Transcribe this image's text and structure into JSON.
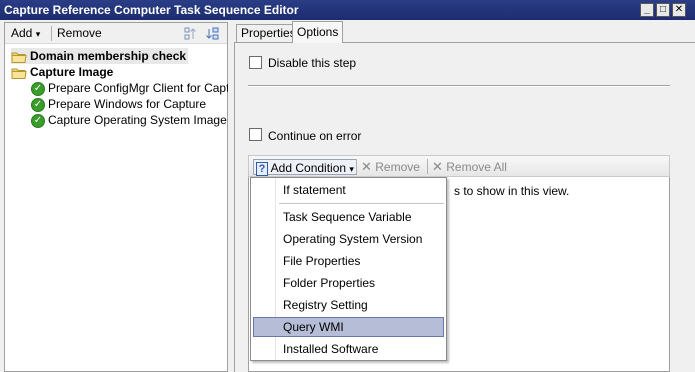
{
  "window": {
    "title": "Capture Reference Computer Task Sequence Editor",
    "controls": {
      "minimize": "_",
      "maximize": "□",
      "close": "✕"
    }
  },
  "left_toolbar": {
    "add_label": "Add",
    "add_arrow": "▾",
    "remove_label": "Remove",
    "icons": [
      "move-up-icon",
      "move-down-icon"
    ]
  },
  "tree": {
    "groups": [
      {
        "label": "Domain membership check",
        "icon": "folder-icon",
        "selected": true
      },
      {
        "label": "Capture Image",
        "icon": "folder-icon",
        "selected": false
      }
    ],
    "steps": [
      {
        "label": "Prepare ConfigMgr Client for Capture",
        "icon": "check-icon"
      },
      {
        "label": "Prepare Windows for Capture",
        "icon": "check-icon"
      },
      {
        "label": "Capture Operating System Image",
        "icon": "check-icon"
      }
    ]
  },
  "tabs": [
    {
      "label": "Properties",
      "active": false
    },
    {
      "label": "Options",
      "active": true
    }
  ],
  "options": {
    "disable_step_label": "Disable this step",
    "disable_step_checked": false,
    "continue_on_error_label": "Continue on error",
    "continue_on_error_checked": false
  },
  "conditions_toolbar": {
    "add_condition_label": "Add Condition",
    "add_condition_arrow": "▾",
    "remove_label": "Remove",
    "remove_all_label": "Remove All",
    "x_glyph": "✕",
    "help_glyph": "?"
  },
  "conditions_area": {
    "empty_text_visible": "s to show in this view."
  },
  "add_condition_menu": {
    "items": [
      {
        "label": "If statement",
        "highlighted": false
      },
      {
        "label": "Task Sequence Variable",
        "highlighted": false
      },
      {
        "label": "Operating System Version",
        "highlighted": false
      },
      {
        "label": "File Properties",
        "highlighted": false
      },
      {
        "label": "Folder Properties",
        "highlighted": false
      },
      {
        "label": "Registry Setting",
        "highlighted": false
      },
      {
        "label": "Query WMI",
        "highlighted": true
      },
      {
        "label": "Installed Software",
        "highlighted": false
      }
    ]
  },
  "colors": {
    "titlebar": "#1c2c6e",
    "menu_highlight": "#b5bdd7",
    "check_green": "#3a9c2a"
  }
}
